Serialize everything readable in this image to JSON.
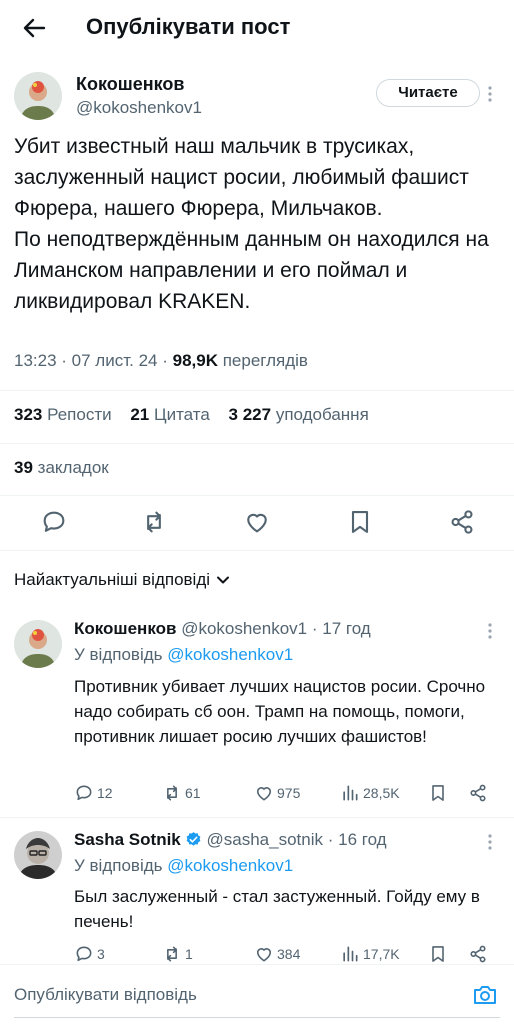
{
  "header": {
    "title": "Опублікувати пост"
  },
  "post": {
    "author_name": "Кокошенков",
    "author_handle": "@kokoshenkov1",
    "follow_label": "Читаєте",
    "text": "Убит известный наш мальчик в трусиках, заслуженный нацист росии, любимый фашист Фюрера, нашего Фюрера, Мильчаков.\nПо неподтверждённым данным он находился на Лиманском направлении и его поймал и ликвидировал KRAKEN.",
    "time": "13:23",
    "date": "07 лист. 24",
    "views_count": "98,9K",
    "views_label": "переглядів",
    "reposts_count": "323",
    "reposts_label": "Репости",
    "quotes_count": "21",
    "quotes_label": "Цитата",
    "likes_count": "3 227",
    "likes_label": "уподобання",
    "bookmarks_count": "39",
    "bookmarks_label": "закладок"
  },
  "sort_label": "Найактуальніші відповіді",
  "replies": [
    {
      "name": "Кокошенков",
      "handle": "@kokoshenkov1",
      "age": "17 год",
      "replying_prefix": "У відповідь",
      "replying_to": "@kokoshenkov1",
      "text": "Противник убивает лучших нацистов росии. Срочно надо собирать сб оон. Трамп на помощь, помоги, противник лишает росию лучших фашистов!",
      "replies": "12",
      "reposts": "61",
      "likes": "975",
      "views": "28,5K"
    },
    {
      "name": "Sasha Sotnik",
      "handle": "@sasha_sotnik",
      "age": "16 год",
      "replying_prefix": "У відповідь",
      "replying_to": "@kokoshenkov1",
      "text": "Был заслуженный - стал застуженный. Гойду ему в печень!",
      "replies": "3",
      "reposts": "1",
      "likes": "384",
      "views": "17,7K"
    }
  ],
  "composer": {
    "placeholder": "Опублікувати відповідь"
  },
  "colors": {
    "accent": "#1d9bf0",
    "secondary_text": "#536471",
    "primary_text": "#0f1419"
  }
}
